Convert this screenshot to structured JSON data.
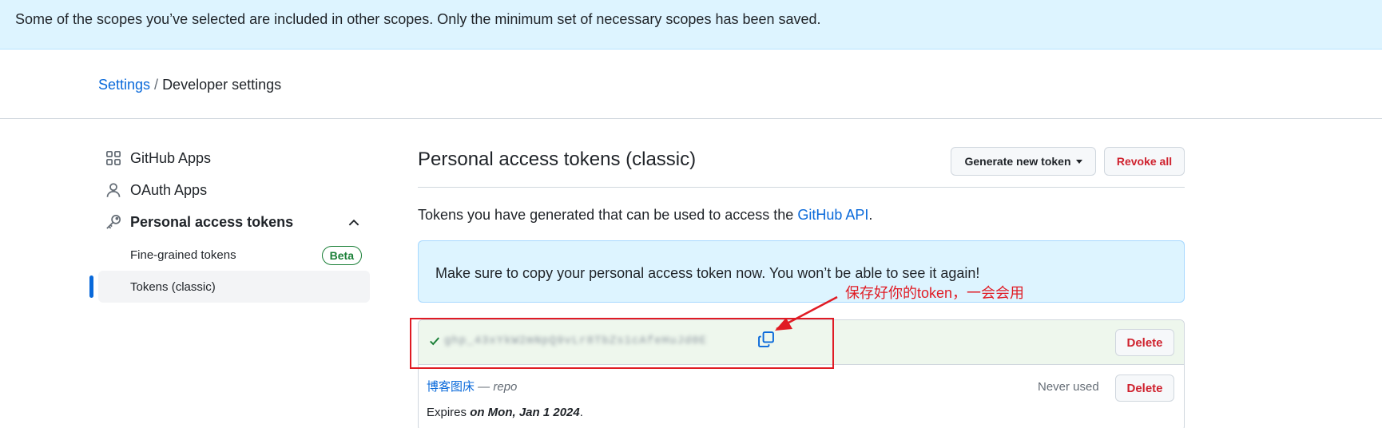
{
  "flash": {
    "message": "Some of the scopes you’ve selected are included in other scopes. Only the minimum set of necessary scopes has been saved."
  },
  "breadcrumb": {
    "root": "Settings",
    "separator": "/",
    "current": "Developer settings"
  },
  "sidebar": {
    "items": [
      {
        "label": "GitHub Apps",
        "icon": "apps-icon"
      },
      {
        "label": "OAuth Apps",
        "icon": "person-icon"
      },
      {
        "label": "Personal access tokens",
        "icon": "key-icon"
      }
    ],
    "sub_items": [
      {
        "label": "Fine-grained tokens",
        "badge": "Beta"
      },
      {
        "label": "Tokens (classic)",
        "active": true
      }
    ]
  },
  "main": {
    "title": "Personal access tokens (classic)",
    "generate_button": "Generate new token",
    "revoke_button": "Revoke all",
    "intro_prefix": "Tokens you have generated that can be used to access the ",
    "intro_link": "GitHub API",
    "intro_suffix": ".",
    "notice": "Make sure to copy your personal access token now. You won’t be able to see it again!"
  },
  "annotation": {
    "text": "保存好你的token，一会会用"
  },
  "new_token": {
    "value": "ghp_43xYkW2mNpQ9vLr8TbZs1cAfeHuJd0E",
    "delete_label": "Delete"
  },
  "tokens": [
    {
      "name": "博客图床",
      "scope_separator": " — ",
      "scope": "repo",
      "last_used": "Never used",
      "expires_prefix": "Expires ",
      "expires_date": "on Mon, Jan 1 2024",
      "expires_suffix": ".",
      "delete_label": "Delete"
    }
  ],
  "colors": {
    "accent": "#0969da",
    "danger": "#cf222e",
    "success": "#1a7f37",
    "annotation": "#e01b24",
    "flash_bg": "#ddf4ff"
  }
}
